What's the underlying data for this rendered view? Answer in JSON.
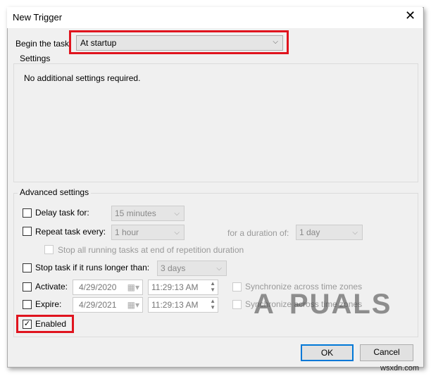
{
  "window": {
    "title": "New Trigger",
    "close_icon": "close-icon"
  },
  "begin": {
    "label": "Begin the task:",
    "value": "At startup"
  },
  "settings": {
    "label": "Settings",
    "message": "No additional settings required."
  },
  "advanced": {
    "label": "Advanced settings",
    "delay": {
      "label": "Delay task for:",
      "value": "15 minutes",
      "checked": false
    },
    "repeat": {
      "label": "Repeat task every:",
      "value": "1 hour",
      "checked": false,
      "duration_label": "for a duration of:",
      "duration_value": "1 day"
    },
    "stop_all": {
      "label": "Stop all running tasks at end of repetition duration",
      "checked": false
    },
    "stop_task": {
      "label": "Stop task if it runs longer than:",
      "value": "3 days",
      "checked": false
    },
    "activate": {
      "label": "Activate:",
      "date": "4/29/2020",
      "time": "11:29:13 AM",
      "sync": "Synchronize across time zones",
      "checked": false
    },
    "expire": {
      "label": "Expire:",
      "date": "4/29/2021",
      "time": "11:29:13 AM",
      "sync": "Synchronize across time zones",
      "checked": false
    },
    "enabled": {
      "label": "Enabled",
      "checked": true
    }
  },
  "buttons": {
    "ok": "OK",
    "cancel": "Cancel"
  },
  "highlight_color": "#e0141e",
  "watermarks": {
    "logo": "APPUALS",
    "site": "wsxdn.com"
  }
}
